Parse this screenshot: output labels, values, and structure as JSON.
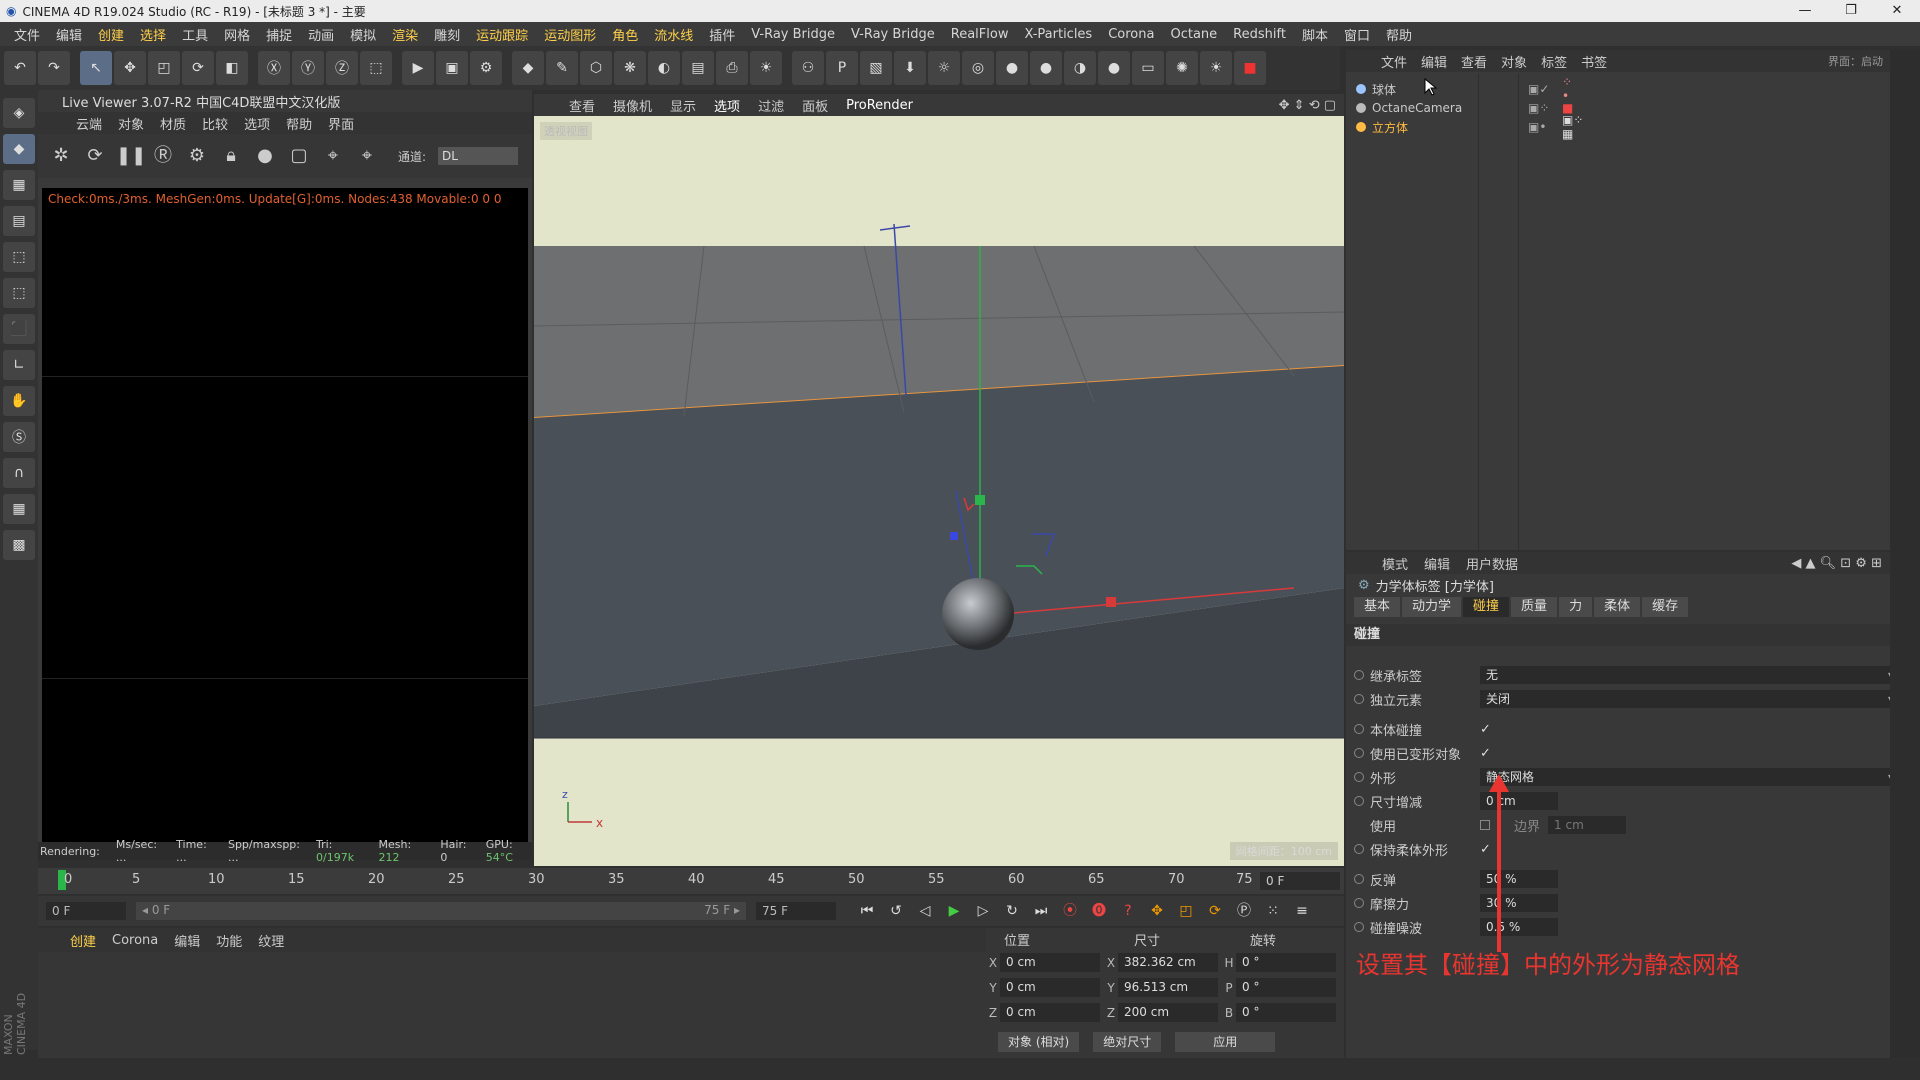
{
  "window": {
    "title": "CINEMA 4D R19.024 Studio (RC - R19) - [未标题 3 *] - 主要",
    "min": "—",
    "max": "❐",
    "close": "✕"
  },
  "menubar": [
    "文件",
    "编辑",
    "创建",
    "选择",
    "工具",
    "网格",
    "捕捉",
    "动画",
    "模拟",
    "渲染",
    "雕刻",
    "运动跟踪",
    "运动图形",
    "角色",
    "流水线",
    "插件",
    "V-Ray Bridge",
    "V-Ray Bridge",
    "RealFlow",
    "X-Particles",
    "Corona",
    "Octane",
    "Redshift",
    "脚本",
    "窗口",
    "帮助"
  ],
  "liveviewer": {
    "title": "Live Viewer 3.07-R2 中国C4D联盟中文汉化版",
    "menu": [
      "云端",
      "对象",
      "材质",
      "比较",
      "选项",
      "帮助",
      "界面"
    ],
    "channel_label": "通道:",
    "channel_value": "DL",
    "stats": "Check:0ms./3ms. MeshGen:0ms. Update[G]:0ms. Nodes:438 Movable:0  0 0",
    "footer": {
      "rendering": "Rendering:",
      "mssec": "Ms/sec: ...",
      "time": "Time: ...",
      "spp": "Spp/maxspp: ...",
      "tri_label": "Tri:",
      "tri": "0/197k",
      "mesh_label": "Mesh:",
      "mesh": "212",
      "hair": "Hair: 0",
      "gpu_label": "GPU:",
      "gpu": "54°C"
    }
  },
  "viewport": {
    "menu": [
      "查看",
      "摄像机",
      "显示",
      "选项",
      "过滤",
      "面板",
      "ProRender"
    ],
    "corner_label": "透视视图",
    "grid_label": "网格间距：100 cm"
  },
  "timeline": {
    "ticks": [
      "0",
      "5",
      "10",
      "15",
      "20",
      "25",
      "30",
      "35",
      "40",
      "45",
      "50",
      "55",
      "60",
      "65",
      "70",
      "75"
    ],
    "frame": "0 F",
    "start": "0 F",
    "range_start": "◂ 0 F",
    "range_end": "75 F ▸",
    "end": "75 F"
  },
  "bottom_menu": [
    "创建",
    "Corona",
    "编辑",
    "功能",
    "纹理"
  ],
  "coords": {
    "headers": [
      "位置",
      "尺寸",
      "旋转"
    ],
    "rows": [
      {
        "axis": "X",
        "pos": "0 cm",
        "sizeAxis": "X",
        "size": "382.362 cm",
        "rotAxis": "H",
        "rot": "0 °"
      },
      {
        "axis": "Y",
        "pos": "0 cm",
        "sizeAxis": "Y",
        "size": "96.513 cm",
        "rotAxis": "P",
        "rot": "0 °"
      },
      {
        "axis": "Z",
        "pos": "0 cm",
        "sizeAxis": "Z",
        "size": "200 cm",
        "rotAxis": "B",
        "rot": "0 °"
      }
    ],
    "mode": "对象 (相对)",
    "size_mode": "绝对尺寸",
    "apply": "应用"
  },
  "object_manager": {
    "menu": [
      "文件",
      "编辑",
      "查看",
      "对象",
      "标签",
      "书签"
    ],
    "objects": [
      {
        "name": "球体",
        "color": "#9cc4ff"
      },
      {
        "name": "OctaneCamera",
        "color": "#bbbbbb"
      },
      {
        "name": "立方体",
        "color": "#ffbb44"
      }
    ],
    "top_right": "界面：启动"
  },
  "attribute_manager": {
    "menu": [
      "模式",
      "编辑",
      "用户数据"
    ],
    "tag_title": "力学体标签 [力学体]",
    "tabs": [
      "基本",
      "动力学",
      "碰撞",
      "质量",
      "力",
      "柔体",
      "缓存"
    ],
    "active_tab": "碰撞",
    "section": "碰撞",
    "props": [
      {
        "label": "继承标签",
        "type": "drop",
        "value": "无"
      },
      {
        "label": "独立元素",
        "type": "drop",
        "value": "关闭"
      },
      {
        "label": "本体碰撞",
        "type": "check",
        "value": "✓"
      },
      {
        "label": "使用已变形对象",
        "type": "check",
        "value": "✓"
      },
      {
        "label": "外形",
        "type": "drop",
        "value": "静态网格"
      },
      {
        "label": "尺寸增减",
        "type": "num",
        "value": "0 cm"
      },
      {
        "label": "使用",
        "type": "check",
        "value": ""
      },
      {
        "label": "保持柔体外形",
        "type": "check",
        "value": "✓"
      },
      {
        "label": "反弹",
        "type": "num",
        "value": "50 %"
      },
      {
        "label": "摩擦力",
        "type": "num",
        "value": "30 %"
      },
      {
        "label": "碰撞噪波",
        "type": "num",
        "value": "0.5 %"
      }
    ],
    "border_label": "边界",
    "border_value": "1 cm"
  },
  "annotation": "设置其【碰撞】中的外形为静态网格",
  "branding": "MAXON CINEMA 4D"
}
